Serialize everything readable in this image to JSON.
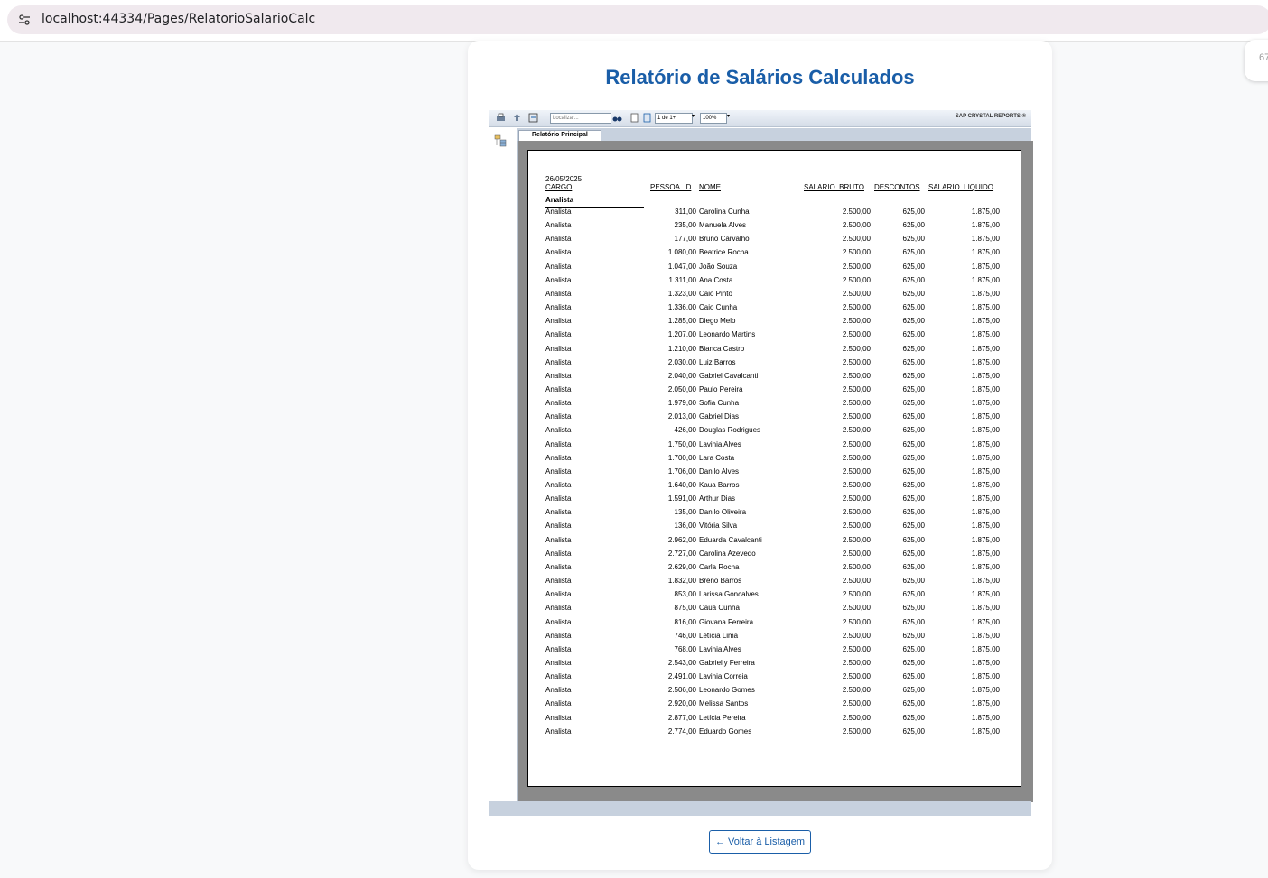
{
  "browser": {
    "url": "localhost:44334/Pages/RelatorioSalarioCalc",
    "side_tab_text": "67"
  },
  "page_title": "Relatório de Salários Calculados",
  "toolbar": {
    "search_placeholder": "Localizar...",
    "page_indicator": "1 de 1+",
    "zoom": "100%",
    "brand": "SAP CRYSTAL REPORTS ®"
  },
  "tab_label": "Relatório Principal",
  "report": {
    "date": "26/05/2025",
    "headers": {
      "cargo": "CARGO",
      "pessoa_id": "PESSOA_ID",
      "nome": "NOME",
      "salario_bruto": "SALARIO_BRUTO",
      "descontos": "DESCONTOS",
      "salario_liquido": "SALARIO_LIQUIDO"
    },
    "group_label": "Analista",
    "rows": [
      {
        "cargo": "Analista",
        "id": "311,00",
        "nome": "Carolina Cunha",
        "bruto": "2.500,00",
        "desc": "625,00",
        "liq": "1.875,00"
      },
      {
        "cargo": "Analista",
        "id": "235,00",
        "nome": "Manuela Alves",
        "bruto": "2.500,00",
        "desc": "625,00",
        "liq": "1.875,00"
      },
      {
        "cargo": "Analista",
        "id": "177,00",
        "nome": "Bruno Carvalho",
        "bruto": "2.500,00",
        "desc": "625,00",
        "liq": "1.875,00"
      },
      {
        "cargo": "Analista",
        "id": "1.080,00",
        "nome": "Beatrice Rocha",
        "bruto": "2.500,00",
        "desc": "625,00",
        "liq": "1.875,00"
      },
      {
        "cargo": "Analista",
        "id": "1.047,00",
        "nome": "João Souza",
        "bruto": "2.500,00",
        "desc": "625,00",
        "liq": "1.875,00"
      },
      {
        "cargo": "Analista",
        "id": "1.311,00",
        "nome": "Ana Costa",
        "bruto": "2.500,00",
        "desc": "625,00",
        "liq": "1.875,00"
      },
      {
        "cargo": "Analista",
        "id": "1.323,00",
        "nome": "Caio Pinto",
        "bruto": "2.500,00",
        "desc": "625,00",
        "liq": "1.875,00"
      },
      {
        "cargo": "Analista",
        "id": "1.336,00",
        "nome": "Caio Cunha",
        "bruto": "2.500,00",
        "desc": "625,00",
        "liq": "1.875,00"
      },
      {
        "cargo": "Analista",
        "id": "1.285,00",
        "nome": "Diego Melo",
        "bruto": "2.500,00",
        "desc": "625,00",
        "liq": "1.875,00"
      },
      {
        "cargo": "Analista",
        "id": "1.207,00",
        "nome": "Leonardo Martins",
        "bruto": "2.500,00",
        "desc": "625,00",
        "liq": "1.875,00"
      },
      {
        "cargo": "Analista",
        "id": "1.210,00",
        "nome": "Bianca Castro",
        "bruto": "2.500,00",
        "desc": "625,00",
        "liq": "1.875,00"
      },
      {
        "cargo": "Analista",
        "id": "2.030,00",
        "nome": "Luiz Barros",
        "bruto": "2.500,00",
        "desc": "625,00",
        "liq": "1.875,00"
      },
      {
        "cargo": "Analista",
        "id": "2.040,00",
        "nome": "Gabriel Cavalcanti",
        "bruto": "2.500,00",
        "desc": "625,00",
        "liq": "1.875,00"
      },
      {
        "cargo": "Analista",
        "id": "2.050,00",
        "nome": "Paulo Pereira",
        "bruto": "2.500,00",
        "desc": "625,00",
        "liq": "1.875,00"
      },
      {
        "cargo": "Analista",
        "id": "1.979,00",
        "nome": "Sofia Cunha",
        "bruto": "2.500,00",
        "desc": "625,00",
        "liq": "1.875,00"
      },
      {
        "cargo": "Analista",
        "id": "2.013,00",
        "nome": "Gabriel Dias",
        "bruto": "2.500,00",
        "desc": "625,00",
        "liq": "1.875,00"
      },
      {
        "cargo": "Analista",
        "id": "426,00",
        "nome": "Douglas Rodrigues",
        "bruto": "2.500,00",
        "desc": "625,00",
        "liq": "1.875,00"
      },
      {
        "cargo": "Analista",
        "id": "1.750,00",
        "nome": "Lavinia Alves",
        "bruto": "2.500,00",
        "desc": "625,00",
        "liq": "1.875,00"
      },
      {
        "cargo": "Analista",
        "id": "1.700,00",
        "nome": "Lara Costa",
        "bruto": "2.500,00",
        "desc": "625,00",
        "liq": "1.875,00"
      },
      {
        "cargo": "Analista",
        "id": "1.706,00",
        "nome": "Danilo Alves",
        "bruto": "2.500,00",
        "desc": "625,00",
        "liq": "1.875,00"
      },
      {
        "cargo": "Analista",
        "id": "1.640,00",
        "nome": "Kaua Barros",
        "bruto": "2.500,00",
        "desc": "625,00",
        "liq": "1.875,00"
      },
      {
        "cargo": "Analista",
        "id": "1.591,00",
        "nome": "Arthur Dias",
        "bruto": "2.500,00",
        "desc": "625,00",
        "liq": "1.875,00"
      },
      {
        "cargo": "Analista",
        "id": "135,00",
        "nome": "Danilo Oliveira",
        "bruto": "2.500,00",
        "desc": "625,00",
        "liq": "1.875,00"
      },
      {
        "cargo": "Analista",
        "id": "136,00",
        "nome": "Vitória Silva",
        "bruto": "2.500,00",
        "desc": "625,00",
        "liq": "1.875,00"
      },
      {
        "cargo": "Analista",
        "id": "2.962,00",
        "nome": "Eduarda Cavalcanti",
        "bruto": "2.500,00",
        "desc": "625,00",
        "liq": "1.875,00"
      },
      {
        "cargo": "Analista",
        "id": "2.727,00",
        "nome": "Carolina Azevedo",
        "bruto": "2.500,00",
        "desc": "625,00",
        "liq": "1.875,00"
      },
      {
        "cargo": "Analista",
        "id": "2.629,00",
        "nome": "Carla Rocha",
        "bruto": "2.500,00",
        "desc": "625,00",
        "liq": "1.875,00"
      },
      {
        "cargo": "Analista",
        "id": "1.832,00",
        "nome": "Breno Barros",
        "bruto": "2.500,00",
        "desc": "625,00",
        "liq": "1.875,00"
      },
      {
        "cargo": "Analista",
        "id": "853,00",
        "nome": "Larissa Goncalves",
        "bruto": "2.500,00",
        "desc": "625,00",
        "liq": "1.875,00"
      },
      {
        "cargo": "Analista",
        "id": "875,00",
        "nome": "Cauã Cunha",
        "bruto": "2.500,00",
        "desc": "625,00",
        "liq": "1.875,00"
      },
      {
        "cargo": "Analista",
        "id": "816,00",
        "nome": "Giovana Ferreira",
        "bruto": "2.500,00",
        "desc": "625,00",
        "liq": "1.875,00"
      },
      {
        "cargo": "Analista",
        "id": "746,00",
        "nome": "Letícia Lima",
        "bruto": "2.500,00",
        "desc": "625,00",
        "liq": "1.875,00"
      },
      {
        "cargo": "Analista",
        "id": "768,00",
        "nome": "Lavinia Alves",
        "bruto": "2.500,00",
        "desc": "625,00",
        "liq": "1.875,00"
      },
      {
        "cargo": "Analista",
        "id": "2.543,00",
        "nome": "Gabrielly Ferreira",
        "bruto": "2.500,00",
        "desc": "625,00",
        "liq": "1.875,00"
      },
      {
        "cargo": "Analista",
        "id": "2.491,00",
        "nome": "Lavinia Correia",
        "bruto": "2.500,00",
        "desc": "625,00",
        "liq": "1.875,00"
      },
      {
        "cargo": "Analista",
        "id": "2.506,00",
        "nome": "Leonardo Gomes",
        "bruto": "2.500,00",
        "desc": "625,00",
        "liq": "1.875,00"
      },
      {
        "cargo": "Analista",
        "id": "2.920,00",
        "nome": "Melissa Santos",
        "bruto": "2.500,00",
        "desc": "625,00",
        "liq": "1.875,00"
      },
      {
        "cargo": "Analista",
        "id": "2.877,00",
        "nome": "Letícia Pereira",
        "bruto": "2.500,00",
        "desc": "625,00",
        "liq": "1.875,00"
      },
      {
        "cargo": "Analista",
        "id": "2.774,00",
        "nome": "Eduardo Gomes",
        "bruto": "2.500,00",
        "desc": "625,00",
        "liq": "1.875,00"
      }
    ]
  },
  "back_button": "Voltar à Listagem",
  "colors": {
    "accent": "#1a5ea8"
  }
}
